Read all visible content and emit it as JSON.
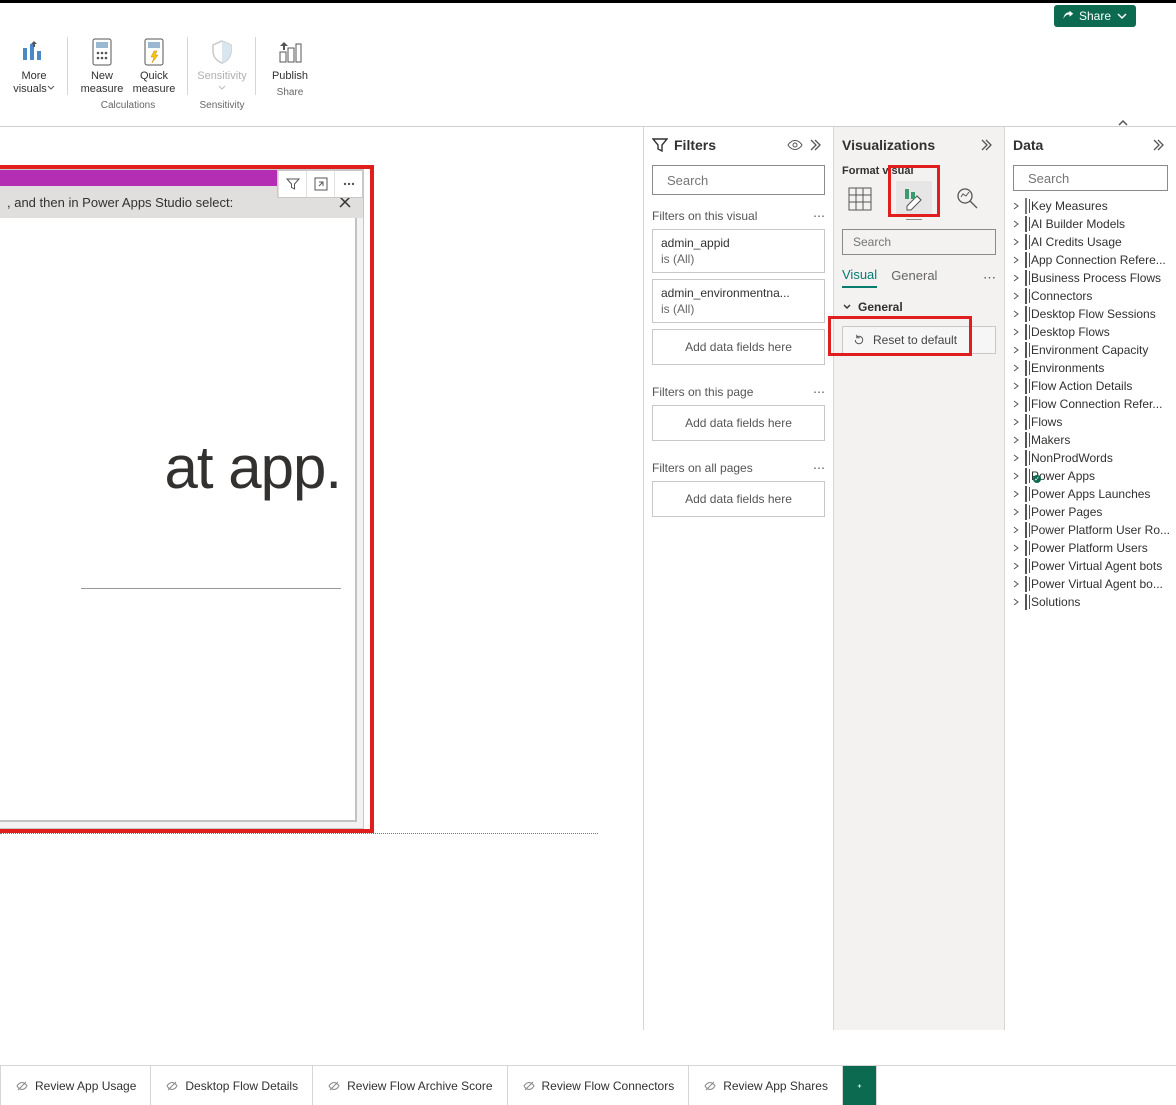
{
  "topbar": {
    "share": "Share"
  },
  "ribbon": {
    "more_visuals": "More visuals",
    "new_measure": "New measure",
    "quick_measure": "Quick measure",
    "sensitivity": "Sensitivity",
    "publish": "Publish",
    "group_calculations": "Calculations",
    "group_sensitivity": "Sensitivity",
    "group_share": "Share"
  },
  "visual": {
    "header_text": ", and then in Power Apps Studio select:",
    "body_text": "at app."
  },
  "filters": {
    "title": "Filters",
    "search_placeholder": "Search",
    "section_visual": "Filters on this visual",
    "section_page": "Filters on this page",
    "section_all": "Filters on all pages",
    "add_placeholder": "Add data fields here",
    "items": [
      {
        "name": "admin_appid",
        "value": "is (All)"
      },
      {
        "name": "admin_environmentna...",
        "value": "is (All)"
      }
    ]
  },
  "viz": {
    "title": "Visualizations",
    "subtitle": "Format visual",
    "search_placeholder": "Search",
    "tabs": {
      "visual": "Visual",
      "general": "General"
    },
    "section_general": "General",
    "reset": "Reset to default"
  },
  "data": {
    "title": "Data",
    "search_placeholder": "Search",
    "tables": [
      "Key Measures",
      "AI Builder Models",
      "AI Credits Usage",
      "App Connection Refere...",
      "Business Process Flows",
      "Connectors",
      "Desktop Flow Sessions",
      "Desktop Flows",
      "Environment Capacity",
      "Environments",
      "Flow Action Details",
      "Flow Connection Refer...",
      "Flows",
      "Makers",
      "NonProdWords",
      "Power Apps",
      "Power Apps Launches",
      "Power Pages",
      "Power Platform User Ro...",
      "Power Platform Users",
      "Power Virtual Agent bots",
      "Power Virtual Agent bo...",
      "Solutions"
    ],
    "selected_index": 15
  },
  "tabs": [
    "Review App Usage",
    "Desktop Flow Details",
    "Review Flow Archive Score",
    "Review Flow Connectors",
    "Review App Shares"
  ]
}
